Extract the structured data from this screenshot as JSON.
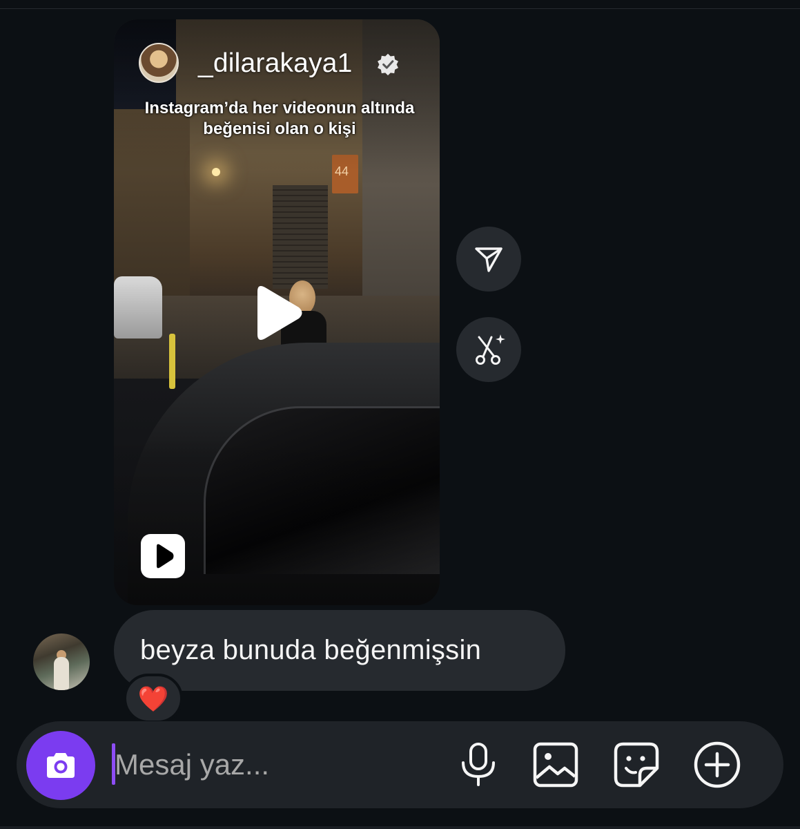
{
  "reel": {
    "username": "_dilarakaya1",
    "verified": true,
    "caption": "Instagram’da her videonun altında beğenisi olan o kişi",
    "sign_text": "44"
  },
  "message": {
    "text": "beyza bunuda beğenmişsin",
    "reaction": "❤️"
  },
  "composer": {
    "placeholder": "Mesaj yaz..."
  },
  "colors": {
    "background": "#0c1014",
    "bubble": "#262a2f",
    "composer": "#1f2328",
    "accent": "#7b3cf0"
  },
  "icons": {
    "share": "paper-plane-icon",
    "remix": "remix-sparkle-icon",
    "camera": "camera-icon",
    "mic": "microphone-icon",
    "gallery": "image-gallery-icon",
    "sticker": "sticker-icon",
    "plus": "plus-circle-icon"
  }
}
